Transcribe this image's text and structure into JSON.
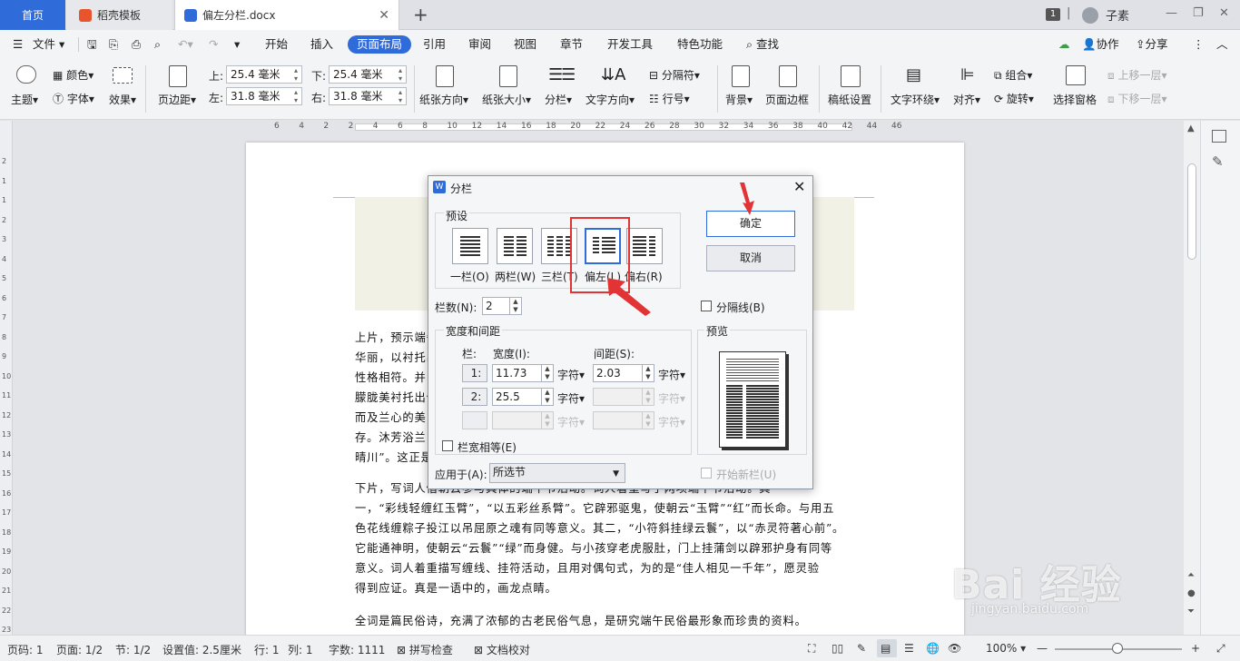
{
  "tabs": {
    "home": "首页",
    "template": "稻壳模板",
    "doc": "偏左分栏.docx",
    "window_count": "1",
    "user": "子素"
  },
  "menu": {
    "file": "文件",
    "items": [
      "开始",
      "插入",
      "页面布局",
      "引用",
      "审阅",
      "视图",
      "章节",
      "开发工具",
      "特色功能"
    ],
    "search": "查找",
    "collab": "协作",
    "share": "分享"
  },
  "ribbon": {
    "theme": "主题",
    "color": "颜色",
    "font": "字体",
    "effect": "效果",
    "margin": "页边距",
    "top_label": "上:",
    "top_value": "25.4 毫米",
    "bottom_label": "下:",
    "bottom_value": "25.4 毫米",
    "left_label": "左:",
    "left_value": "31.8 毫米",
    "right_label": "右:",
    "right_value": "31.8 毫米",
    "orientation": "纸张方向",
    "size": "纸张大小",
    "columns": "分栏",
    "text_direction": "文字方向",
    "separator": "分隔符",
    "line_number": "行号",
    "background": "背景",
    "page_border": "页面边框",
    "manuscript": "稿纸设置",
    "wrap": "文字环绕",
    "align": "对齐",
    "group": "组合",
    "rotate": "旋转",
    "selection_pane": "选择窗格",
    "bring_forward": "上移一层",
    "send_backward": "下移一层"
  },
  "ruler_ticks": [
    "6",
    "4",
    "2",
    "2",
    "4",
    "6",
    "8",
    "10",
    "12",
    "14",
    "16",
    "18",
    "20",
    "22",
    "24",
    "26",
    "28",
    "30",
    "32",
    "34",
    "36",
    "38",
    "40",
    "42",
    "44",
    "46"
  ],
  "vruler_ticks": [
    "2",
    "1",
    "1",
    "2",
    "3",
    "4",
    "5",
    "6",
    "7",
    "8",
    "9",
    "10",
    "11",
    "12",
    "13",
    "14",
    "15",
    "16",
    "17",
    "18",
    "19",
    "20",
    "21",
    "22",
    "23"
  ],
  "document": {
    "para1": [
      "上片，预示端午节来临，以丝带和香粉等来衬托，显示着自然",
      "华丽，以衬托出一位美丽佳人的形象，和她所处环境的雅静",
      "性格相符。并以丝带、兰花等写佳人之美，以写佳人的肤体",
      "朦胧美衬托出佳人在节日里的欢乐，写佳人浴后，由芳体",
      "而及兰心的美，写佳人品格的高洁，余香犹存，余香犹",
      "存。沐芳浴兰，这是端午节的一个风俗，写浴后涨腻清",
      "晴川”。这正是端午节所特有的情景。"
    ],
    "para2": [
      "下片，写词人借朝云参与具体的端午节活动。词人着重写了两项端午节活动。其",
      "一，“彩线轻缠红玉臂”，“以五彩丝系臂”。它辟邪驱鬼，使朝云“玉臂”“红”而长命。与用五",
      "色花线缠粽子投江以吊屈原之魂有同等意义。其二，“小符斜挂绿云鬟”，以“赤灵符著心前”。",
      "它能通神明，使朝云“云鬟”“绿”而身健。与小孩穿老虎服肚，门上挂蒲剑以辟邪护身有同等",
      "意义。词人着重描写缠线、挂符活动，且用对偶句式，为的是“佳人相见一千年”，愿灵验",
      "得到应证。真是一语中的，画龙点睛。"
    ],
    "para3": "全词是篇民俗诗，充满了浓郁的古老民俗气息，是研究端午民俗最形象而珍贵的资料。"
  },
  "dialog": {
    "title": "分栏",
    "preset_group": "预设",
    "presets": [
      "一栏(O)",
      "两栏(W)",
      "三栏(T)",
      "偏左(L)",
      "偏右(R)"
    ],
    "ok": "确定",
    "cancel": "取消",
    "num_cols_label": "栏数(N):",
    "num_cols_value": "2",
    "separator_line": "分隔线(B)",
    "width_spacing_group": "宽度和间距",
    "col_header": "栏:",
    "width_header": "宽度(I):",
    "spacing_header": "间距(S):",
    "rows": [
      {
        "index": "1:",
        "width": "11.73",
        "width_unit": "字符",
        "spacing": "2.03",
        "spacing_unit": "字符"
      },
      {
        "index": "2:",
        "width": "25.5",
        "width_unit": "字符",
        "spacing": "",
        "spacing_unit": "字符"
      },
      {
        "index": "",
        "width": "",
        "width_unit": "字符",
        "spacing": "",
        "spacing_unit": "字符"
      }
    ],
    "equal_width": "栏宽相等(E)",
    "preview_group": "预览",
    "apply_label": "应用于(A):",
    "apply_value": "所选节",
    "new_column": "开始新栏(U)"
  },
  "status": {
    "page_no": "页码: 1",
    "pages": "页面: 1/2",
    "section": "节: 1/2",
    "setting": "设置值: 2.5厘米",
    "row": "行: 1",
    "col": "列: 1",
    "words": "字数: 1111",
    "spell": "拼写检查",
    "proof": "文档校对",
    "zoom": "100%"
  },
  "watermark": "Bai 经验 jingyan.baidu.com",
  "colors": {
    "accent": "#2f6bd9",
    "highlight": "#e23434"
  }
}
